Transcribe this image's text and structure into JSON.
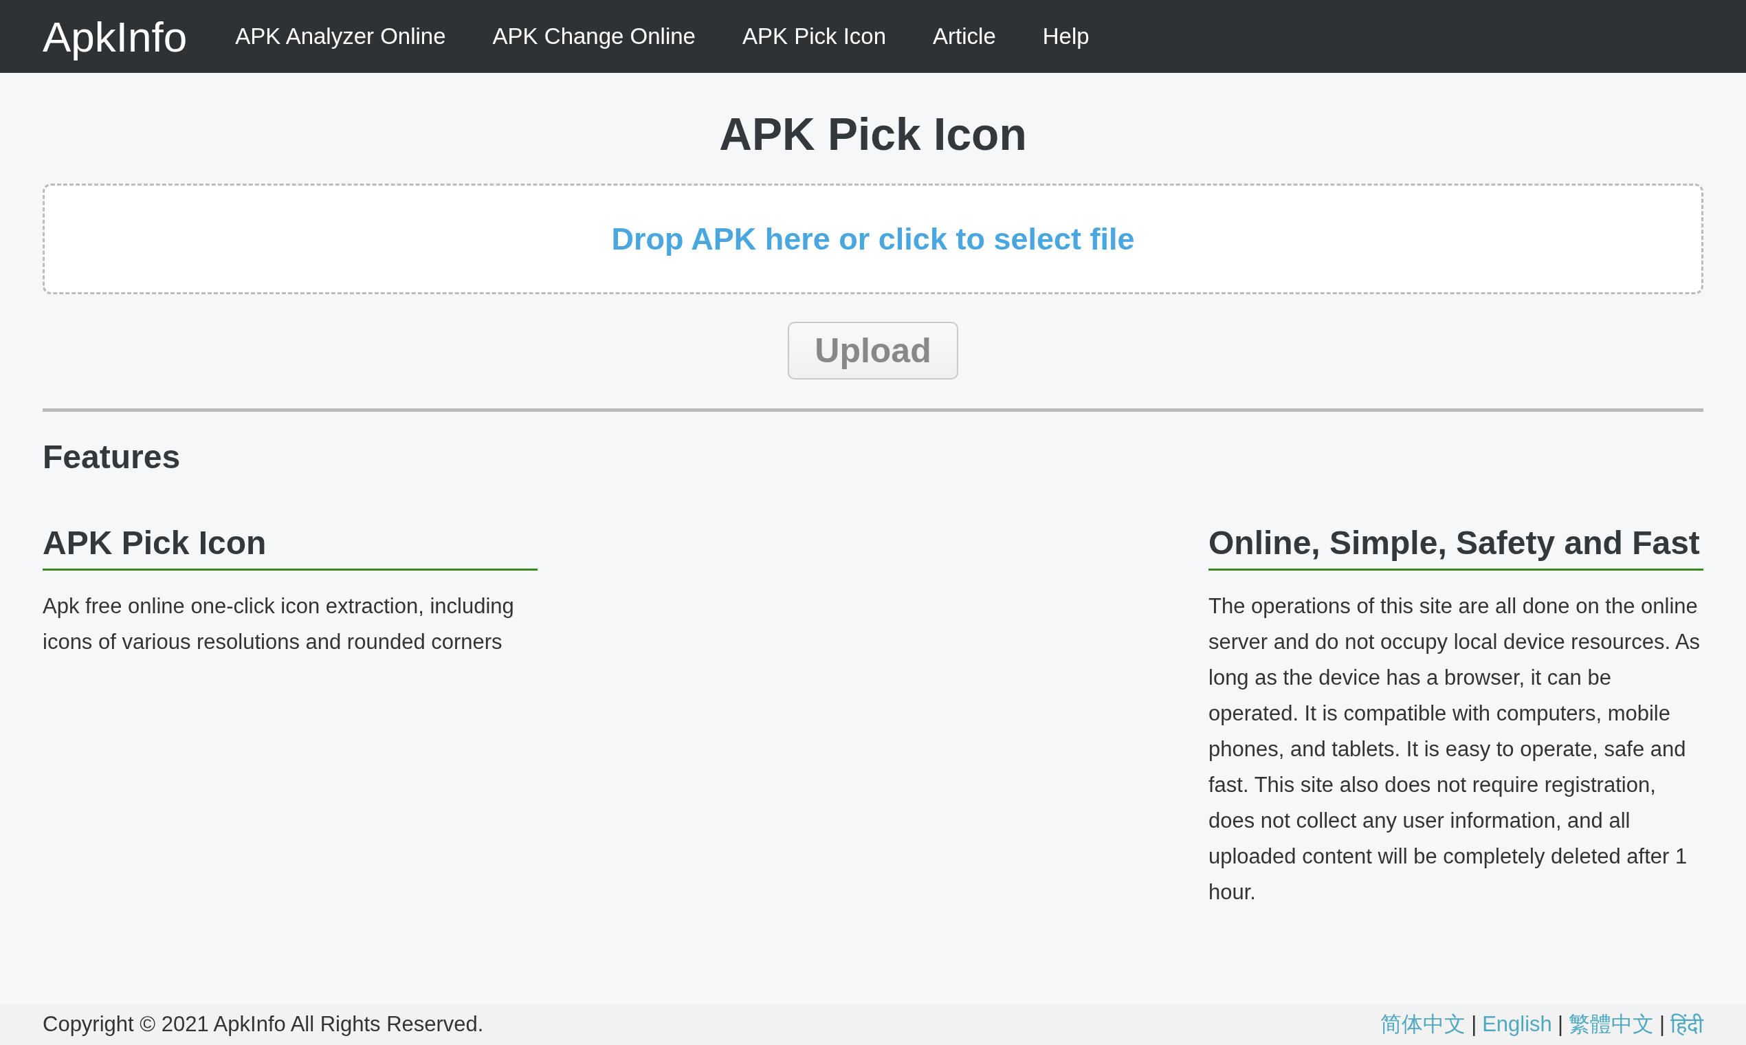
{
  "navbar": {
    "brand": "ApkInfo",
    "links": [
      {
        "label": "APK Analyzer Online"
      },
      {
        "label": "APK Change Online"
      },
      {
        "label": "APK Pick Icon"
      },
      {
        "label": "Article"
      },
      {
        "label": "Help"
      }
    ]
  },
  "page_title": "APK Pick Icon",
  "dropzone": {
    "text": "Drop APK here or click to select file"
  },
  "upload_button": "Upload",
  "features": {
    "heading": "Features",
    "items": [
      {
        "title": "APK Pick Icon",
        "body": "Apk free online one-click icon extraction, including icons of various resolutions and rounded corners"
      },
      {
        "title": "Online, Simple, Safety and Fast",
        "body": "The operations of this site are all done on the online server and do not occupy local device resources. As long as the device has a browser, it can be operated. It is compatible with computers, mobile phones, and tablets. It is easy to operate, safe and fast. This site also does not require registration, does not collect any user information, and all uploaded content will be completely deleted after 1 hour."
      }
    ]
  },
  "footer": {
    "copyright": "Copyright © 2021 ApkInfo All Rights Reserved.",
    "separator": "|",
    "languages": [
      {
        "label": "简体中文"
      },
      {
        "label": "English"
      },
      {
        "label": "繁體中文"
      },
      {
        "label": "हिंदी"
      }
    ]
  }
}
